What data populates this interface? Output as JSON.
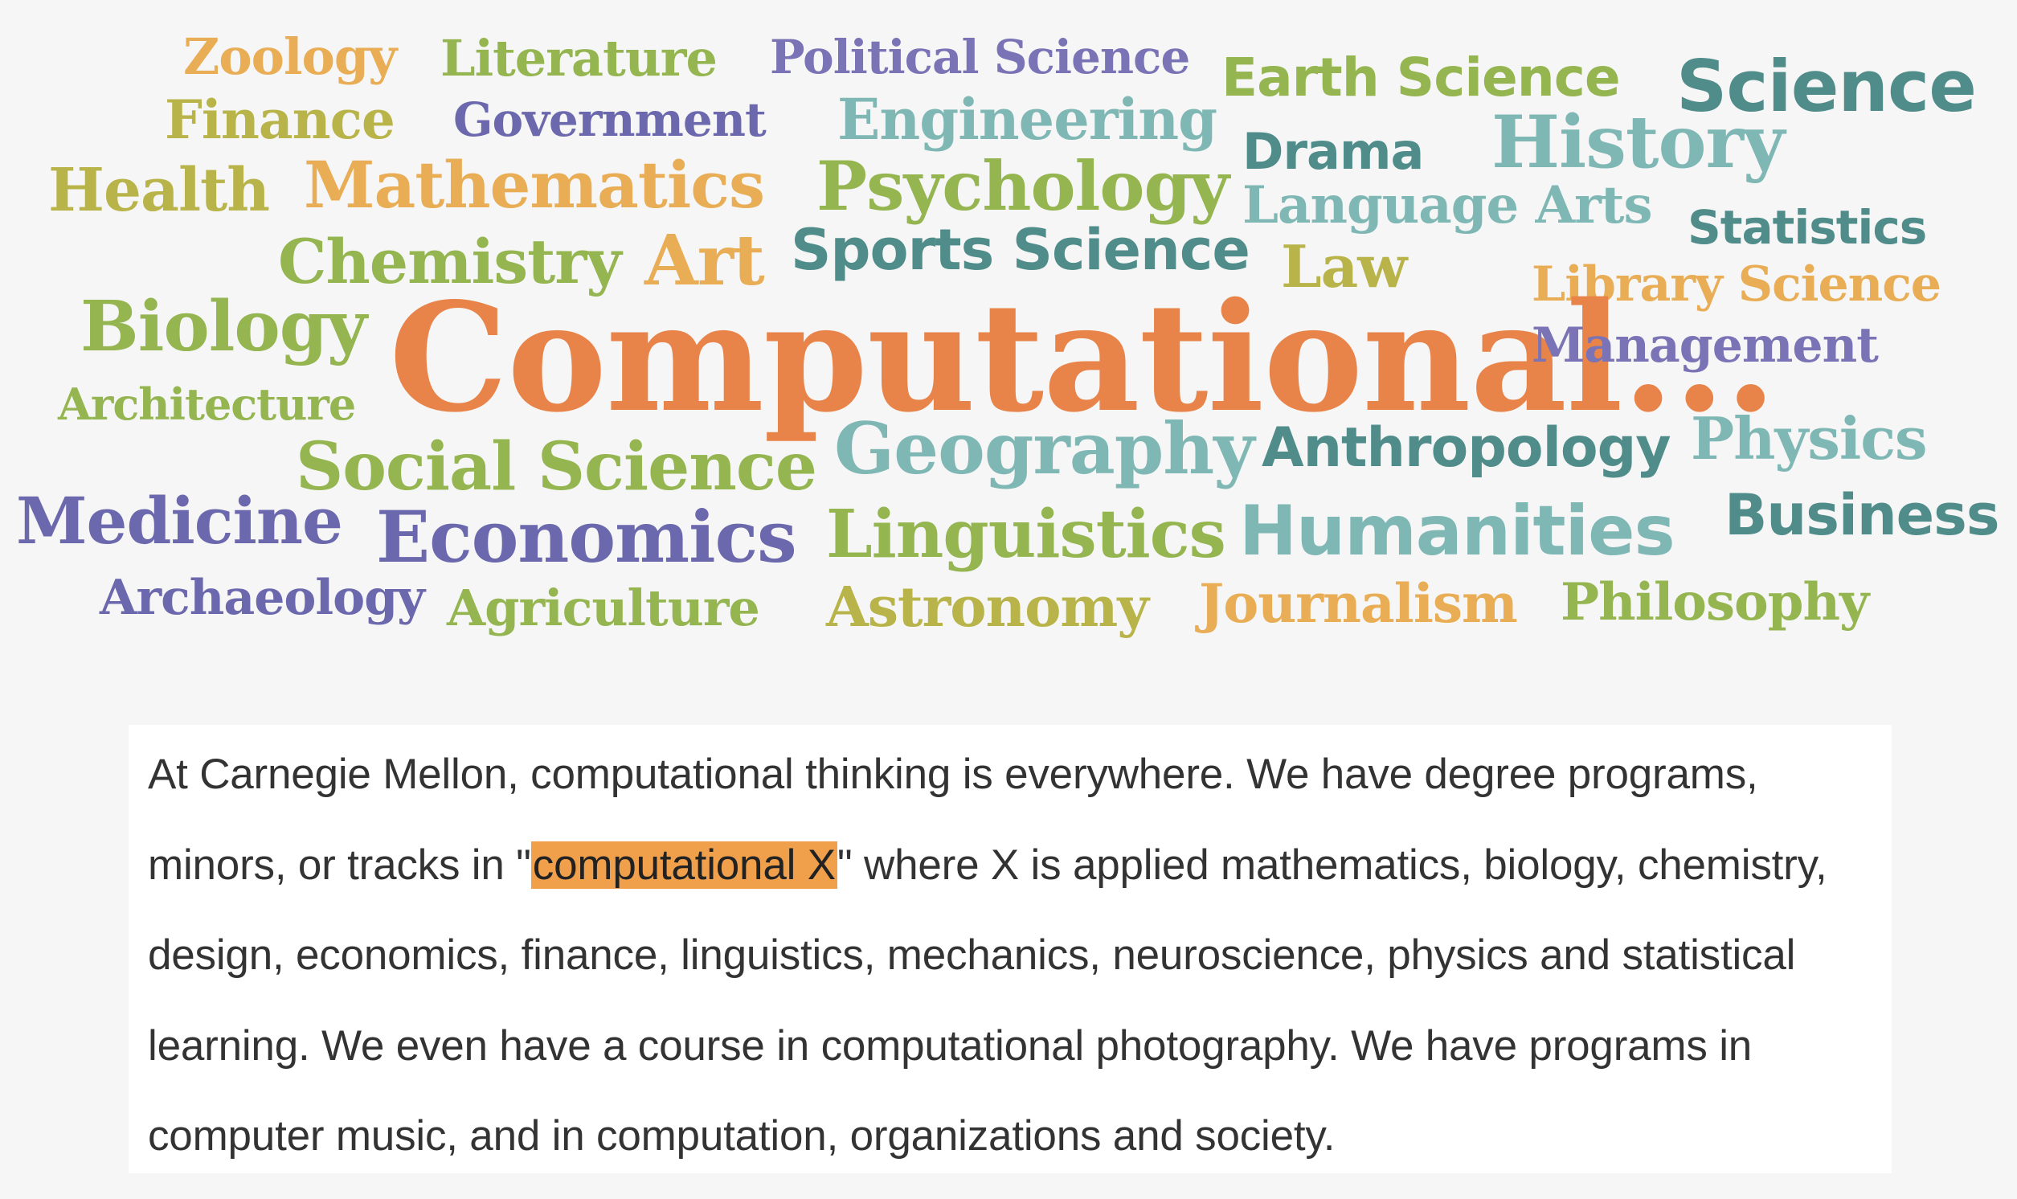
{
  "word_cloud": {
    "words": [
      {
        "id": "zoology",
        "text": "Zoology",
        "color": "#e8ad55"
      },
      {
        "id": "literature",
        "text": "Literature",
        "color": "#94b54f"
      },
      {
        "id": "political-science",
        "text": "Political Science",
        "color": "#7a73b5"
      },
      {
        "id": "earth-science",
        "text": "Earth Science",
        "color": "#94b54f"
      },
      {
        "id": "science",
        "text": "Science",
        "color": "#4f8c8a"
      },
      {
        "id": "finance",
        "text": "Finance",
        "color": "#b9b44a"
      },
      {
        "id": "government",
        "text": "Government",
        "color": "#6c68ad"
      },
      {
        "id": "engineering",
        "text": "Engineering",
        "color": "#7fb7b5"
      },
      {
        "id": "drama",
        "text": "Drama",
        "color": "#4f8c8a"
      },
      {
        "id": "history",
        "text": "History",
        "color": "#7fb7b5"
      },
      {
        "id": "health",
        "text": "Health",
        "color": "#b9b44a"
      },
      {
        "id": "mathematics",
        "text": "Mathematics",
        "color": "#e8ad55"
      },
      {
        "id": "psychology",
        "text": "Psychology",
        "color": "#94b54f"
      },
      {
        "id": "language-arts",
        "text": "Language Arts",
        "color": "#7fb7b5"
      },
      {
        "id": "statistics",
        "text": "Statistics",
        "color": "#4f8c8a"
      },
      {
        "id": "chemistry",
        "text": "Chemistry",
        "color": "#94b54f"
      },
      {
        "id": "art",
        "text": "Art",
        "color": "#e8ad55"
      },
      {
        "id": "sports-science",
        "text": "Sports Science",
        "color": "#4f8c8a"
      },
      {
        "id": "law",
        "text": "Law",
        "color": "#b9b44a"
      },
      {
        "id": "library-science",
        "text": "Library Science",
        "color": "#e8ad55"
      },
      {
        "id": "biology",
        "text": "Biology",
        "color": "#94b54f"
      },
      {
        "id": "computational",
        "text": "Computational...",
        "color": "#e8844a"
      },
      {
        "id": "management",
        "text": "Management",
        "color": "#7a73b5"
      },
      {
        "id": "architecture",
        "text": "Architecture",
        "color": "#94b54f"
      },
      {
        "id": "social-science",
        "text": "Social Science",
        "color": "#94b54f"
      },
      {
        "id": "geography",
        "text": "Geography",
        "color": "#7fb7b5"
      },
      {
        "id": "anthropology",
        "text": "Anthropology",
        "color": "#4f8c8a"
      },
      {
        "id": "physics",
        "text": "Physics",
        "color": "#7fb7b5"
      },
      {
        "id": "medicine",
        "text": "Medicine",
        "color": "#6c68ad"
      },
      {
        "id": "economics",
        "text": "Economics",
        "color": "#6c68ad"
      },
      {
        "id": "linguistics",
        "text": "Linguistics",
        "color": "#94b54f"
      },
      {
        "id": "humanities",
        "text": "Humanities",
        "color": "#7fb7b5"
      },
      {
        "id": "business",
        "text": "Business",
        "color": "#4f8c8a"
      },
      {
        "id": "archaeology",
        "text": "Archaeology",
        "color": "#6c68ad"
      },
      {
        "id": "agriculture",
        "text": "Agriculture",
        "color": "#94b54f"
      },
      {
        "id": "astronomy",
        "text": "Astronomy",
        "color": "#b9b44a"
      },
      {
        "id": "journalism",
        "text": "Journalism",
        "color": "#e8ad55"
      },
      {
        "id": "philosophy",
        "text": "Philosophy",
        "color": "#94b54f"
      }
    ]
  },
  "paragraph": {
    "before_highlight": "At Carnegie Mellon, computational thinking is everywhere. We have degree programs, minors, or tracks in \"",
    "highlight": "computational X",
    "after_highlight": "\" where X is applied mathematics, biology, chemistry, design, economics, finance, linguistics, mechanics, neuroscience, physics and statistical learning. We even have a course in computational photography. We have programs in computer music, and in computation, organizations and society.",
    "highlight_color": "#f0a04b"
  }
}
